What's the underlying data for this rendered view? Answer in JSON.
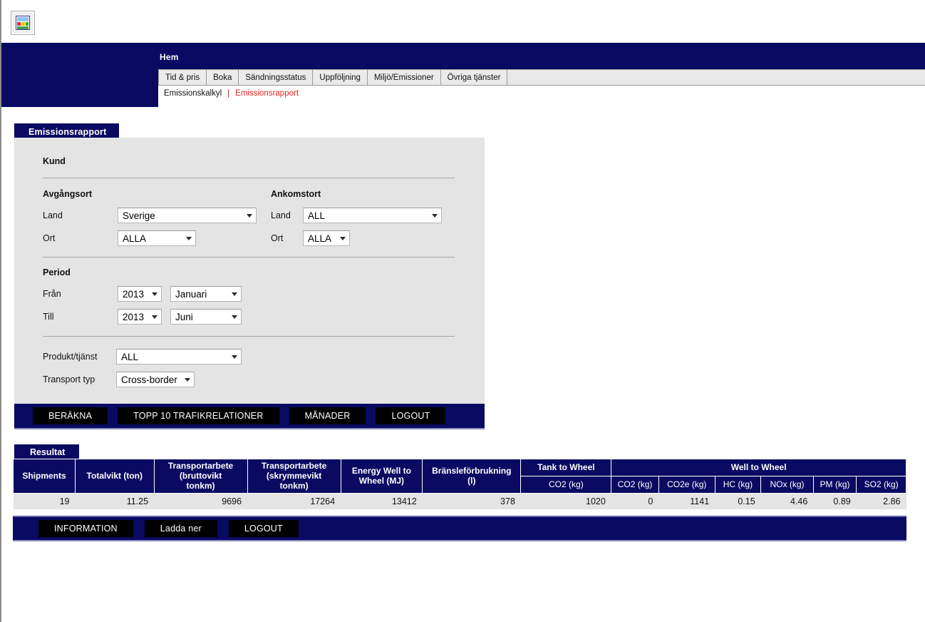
{
  "colors": {
    "navy": "#0a0a63",
    "panel_gray": "#e4e4e4",
    "tab_gray": "#e8e8e8",
    "active_link_red": "#ee2222",
    "button_black": "#000000"
  },
  "header": {
    "logo_icon": "broken-image-icon",
    "home_label": "Hem",
    "tabs": [
      {
        "label": "Tid & pris"
      },
      {
        "label": "Boka"
      },
      {
        "label": "Sändningsstatus"
      },
      {
        "label": "Uppföljning"
      },
      {
        "label": "Miljö/Emissioner"
      },
      {
        "label": "Övriga tjänster"
      }
    ],
    "subnav": {
      "items": [
        {
          "label": "Emissionskalkyl",
          "active": false
        },
        {
          "label": "Emissionsrapport",
          "active": true
        }
      ],
      "separator": "|"
    }
  },
  "form": {
    "section_title": "Emissionsrapport",
    "kund": {
      "label": "Kund"
    },
    "avgangsort": {
      "group_label": "Avgångsort",
      "land": {
        "label": "Land",
        "value": "Sverige"
      },
      "ort": {
        "label": "Ort",
        "value": "ALLA"
      }
    },
    "ankomstort": {
      "group_label": "Ankomstort",
      "land": {
        "label": "Land",
        "value": "ALL"
      },
      "ort": {
        "label": "Ort",
        "value": "ALLA"
      }
    },
    "period": {
      "group_label": "Period",
      "fran": {
        "label": "Från",
        "year": "2013",
        "month": "Januari"
      },
      "till": {
        "label": "Till",
        "year": "2013",
        "month": "Juni"
      }
    },
    "produkt": {
      "label": "Produkt/tjänst",
      "value": "ALL"
    },
    "transport_typ": {
      "label": "Transport typ",
      "value": "Cross-border"
    },
    "buttons": [
      {
        "label": "BERÄKNA"
      },
      {
        "label": "TOPP 10 TRAFIKRELATIONER"
      },
      {
        "label": "MÅNADER"
      },
      {
        "label": "LOGOUT"
      }
    ]
  },
  "result": {
    "section_title": "Resultat",
    "group_headers": {
      "tank_to_wheel": "Tank to Wheel",
      "well_to_wheel": "Well to Wheel"
    },
    "columns": [
      "Shipments",
      "Totalvikt (ton)",
      "Transportarbete (bruttovikt tonkm)",
      "Transportarbete (skrymmevikt tonkm)",
      "Energy Well to Wheel (MJ)",
      "Bränsleförbrukning (l)"
    ],
    "columns_multiline": {
      "shipments": "Shipments",
      "totalvikt": "Totalvikt (ton)",
      "transportarbete_brutto_l1": "Transportarbete",
      "transportarbete_brutto_l2": "(bruttovikt",
      "transportarbete_brutto_l3": "tonkm)",
      "transportarbete_skrym_l1": "Transportarbete",
      "transportarbete_skrym_l2": "(skrymmevikt",
      "transportarbete_skrym_l3": "tonkm)",
      "energy_l1": "Energy Well to",
      "energy_l2": "Wheel (MJ)",
      "bransle_l1": "Bränsleförbrukning",
      "bransle_l2": "(l)"
    },
    "subcolumns": {
      "ttw_co2": "CO2 (kg)",
      "wtw_co2": "CO2 (kg)",
      "wtw_co2e": "CO2e (kg)",
      "wtw_hc": "HC (kg)",
      "wtw_nox": "NOx (kg)",
      "wtw_pm": "PM (kg)",
      "wtw_so2": "SO2 (kg)"
    },
    "row": {
      "shipments": "19",
      "totalvikt": "11.25",
      "transportarbete_brutto": "9696",
      "transportarbete_skrymme": "17264",
      "energy_wtw_mj": "13412",
      "bransleforbrukning": "378",
      "ttw_co2": "1020",
      "wtw_co2": "0",
      "wtw_co2e": "1141",
      "wtw_hc": "0.15",
      "wtw_nox": "4.46",
      "wtw_pm": "0.89",
      "wtw_so2": "2.86"
    },
    "buttons": [
      {
        "label": "INFORMATION"
      },
      {
        "label": "Ladda ner"
      },
      {
        "label": "LOGOUT"
      }
    ]
  }
}
